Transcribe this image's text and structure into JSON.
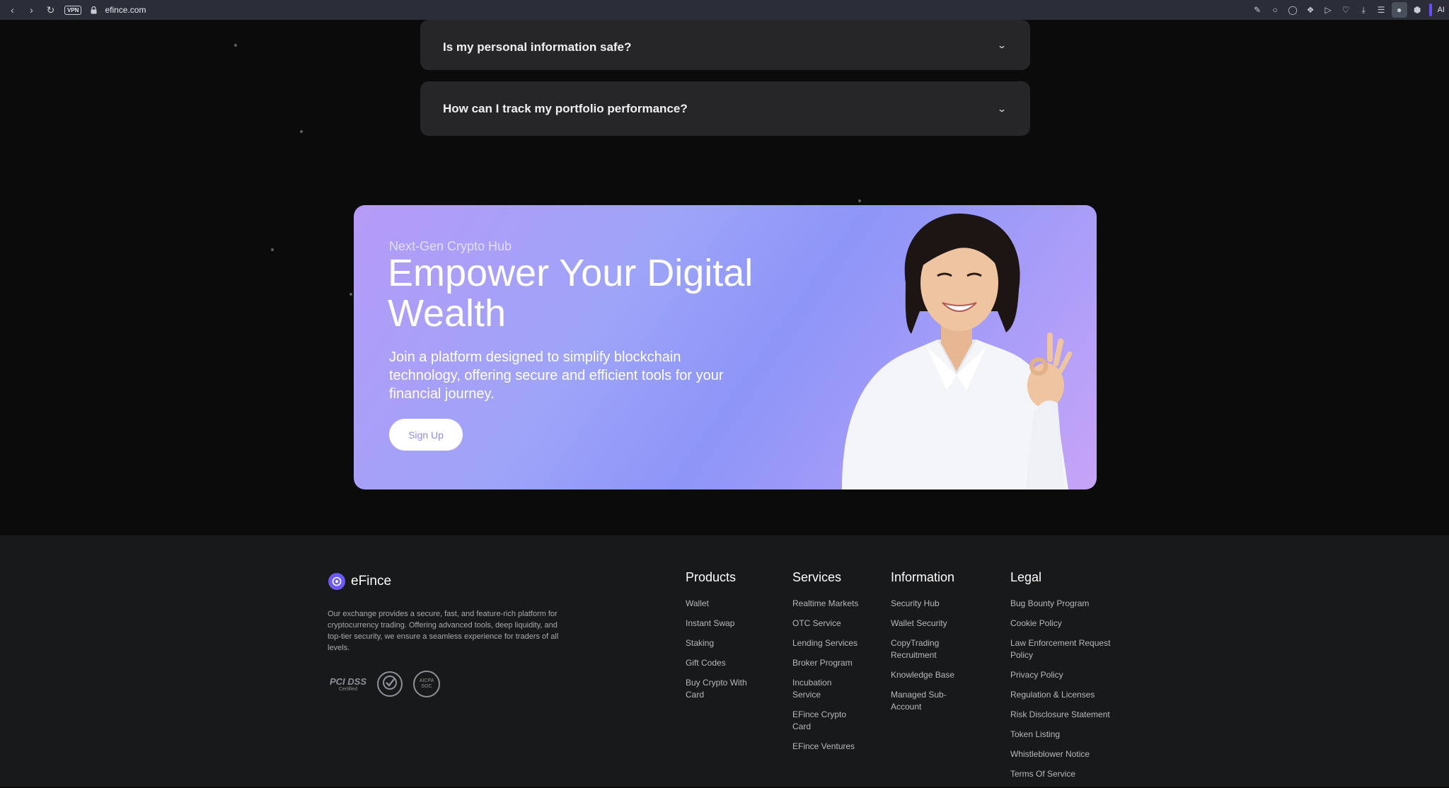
{
  "browser": {
    "vpn_label": "VPN",
    "url": "efince.com",
    "ai_label": "AI"
  },
  "faq": [
    {
      "question": "Is my personal information safe?"
    },
    {
      "question": "How can I track my portfolio performance?"
    }
  ],
  "banner": {
    "eyebrow": "Next-Gen Crypto Hub",
    "headline": "Empower Your Digital Wealth",
    "description": "Join a platform designed to simplify blockchain technology, offering secure and efficient tools for your financial journey.",
    "cta_label": "Sign Up"
  },
  "footer": {
    "brand_name": "eFince",
    "about": "Our exchange provides a secure, fast, and feature-rich platform for cryptocurrency trading. Offering advanced tools, deep liquidity, and top-tier security, we ensure a seamless experience for traders of all levels.",
    "badges": {
      "pci": "PCI DSS",
      "pci_sub": "Certified",
      "aicpa": "AICPA SOC"
    },
    "columns": [
      {
        "title": "Products",
        "links": [
          "Wallet",
          "Instant Swap",
          "Staking",
          "Gift Codes",
          "Buy Crypto With Card"
        ]
      },
      {
        "title": "Services",
        "links": [
          "Realtime Markets",
          "OTC Service",
          "Lending Services",
          "Broker Program",
          "Incubation Service",
          "EFince Crypto Card",
          "EFince Ventures"
        ]
      },
      {
        "title": "Information",
        "links": [
          "Security Hub",
          "Wallet Security",
          "CopyTrading Recruitment",
          "Knowledge Base",
          "Managed Sub-Account"
        ]
      },
      {
        "title": "Legal",
        "links": [
          "Bug Bounty Program",
          "Cookie Policy",
          "Law Enforcement Request Policy",
          "Privacy Policy",
          "Regulation & Licenses",
          "Risk Disclosure Statement",
          "Token Listing",
          "Whistleblower Notice",
          "Terms Of Service"
        ]
      }
    ]
  },
  "colors": {
    "page_bg": "#0b0b0c",
    "faq_bg": "#262629",
    "footer_bg": "#18191b",
    "brand_accent": "#6b5bf2",
    "banner_gradient_start": "#b59bf7",
    "banner_gradient_mid": "#8d95f7"
  }
}
